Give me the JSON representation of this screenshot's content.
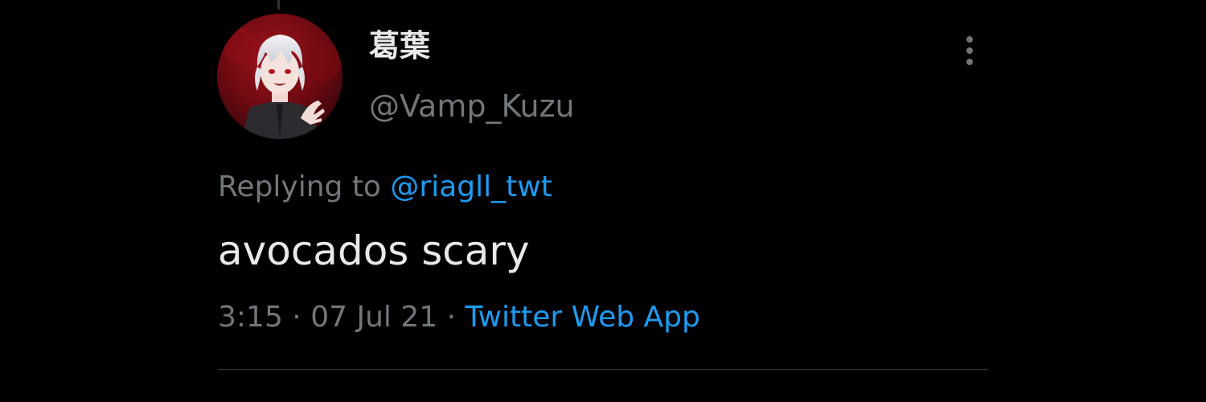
{
  "tweet": {
    "author": {
      "display_name": "葛葉",
      "handle": "@Vamp_Kuzu",
      "avatar_icon": "avatar-vampire-character"
    },
    "reply": {
      "prefix": "Replying to",
      "mention": "@riagll_twt"
    },
    "text": "avocados scary",
    "meta": {
      "time": "3:15",
      "separator": "·",
      "date": "07 Jul 21",
      "source": "Twitter Web App"
    },
    "more_icon": "more-vertical-icon"
  },
  "colors": {
    "background": "#000000",
    "primary_text": "#e7e9ea",
    "secondary_text": "#71767b",
    "accent": "#1d9bf0",
    "divider": "#2f3336"
  }
}
